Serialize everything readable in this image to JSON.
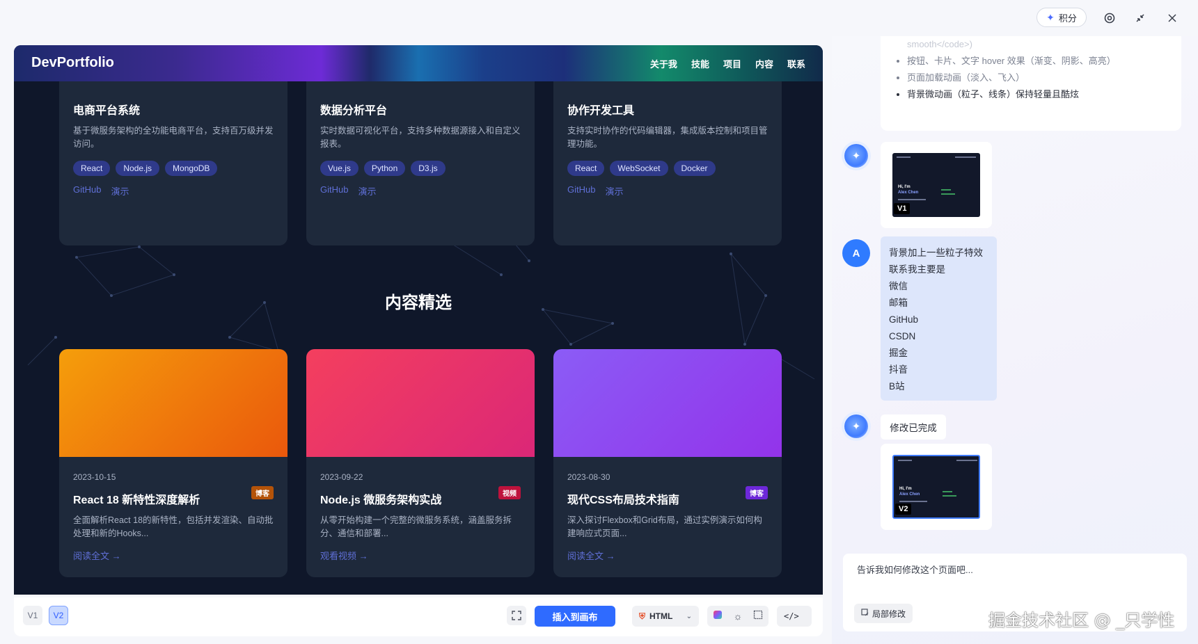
{
  "topbar": {
    "credit_label": "积分",
    "icons": [
      "sparkle-icon",
      "settings-icon",
      "collapse-icon",
      "close-icon"
    ]
  },
  "preview": {
    "nav": {
      "logo": "DevPortfolio",
      "links": [
        "关于我",
        "技能",
        "项目",
        "内容",
        "联系"
      ]
    },
    "projects": [
      {
        "title": "电商平台系统",
        "desc": "基于微服务架构的全功能电商平台，支持百万级并发访问。",
        "tags": [
          "React",
          "Node.js",
          "MongoDB"
        ],
        "links": [
          "GitHub",
          "演示"
        ]
      },
      {
        "title": "数据分析平台",
        "desc": "实时数据可视化平台，支持多种数据源接入和自定义报表。",
        "tags": [
          "Vue.js",
          "Python",
          "D3.js"
        ],
        "links": [
          "GitHub",
          "演示"
        ]
      },
      {
        "title": "协作开发工具",
        "desc": "支持实时协作的代码编辑器，集成版本控制和项目管理功能。",
        "tags": [
          "React",
          "WebSocket",
          "Docker"
        ],
        "links": [
          "GitHub",
          "演示"
        ]
      }
    ],
    "section_title": "内容精选",
    "contents": [
      {
        "date": "2023-10-15",
        "badge": "博客",
        "badge_color": "#b45309",
        "title": "React 18 新特性深度解析",
        "desc": "全面解析React 18的新特性，包括并发渲染、自动批处理和新的Hooks...",
        "more": "阅读全文 →",
        "gradient": [
          "#f59e0b",
          "#ea580c"
        ]
      },
      {
        "date": "2023-09-22",
        "badge": "视频",
        "badge_color": "#be123c",
        "title": "Node.js 微服务架构实战",
        "desc": "从零开始构建一个完整的微服务系统，涵盖服务拆分、通信和部署...",
        "more": "观看视频 →",
        "gradient": [
          "#f43f5e",
          "#db2777"
        ]
      },
      {
        "date": "2023-08-30",
        "badge": "博客",
        "badge_color": "#6d28d9",
        "title": "现代CSS布局技术指南",
        "desc": "深入探讨Flexbox和Grid布局，通过实例演示如何构建响应式页面...",
        "more": "阅读全文 →",
        "gradient": [
          "#8b5cf6",
          "#9333ea"
        ]
      }
    ]
  },
  "toolbar": {
    "versions": [
      "V1",
      "V2"
    ],
    "active_version": "V2",
    "insert_label": "插入到画布",
    "format_label": "HTML",
    "code_label": "</>"
  },
  "chat": {
    "previous_items": [
      "smooth</code>)",
      "按钮、卡片、文字 hover 效果（渐变、阴影、高亮）",
      "页面加载动画（淡入、飞入）",
      "背景微动画（粒子、线条）保持轻量且酷炫"
    ],
    "thumb1_label": "V1",
    "thumb2_label": "V2",
    "thumb_heading": "Hi, I'm",
    "thumb_name": "Alex Chen",
    "user_avatar": "A",
    "user_message_lines": [
      "背景加上一些粒子特效",
      "联系我主要是",
      "微信",
      "邮箱",
      "GitHub",
      "CSDN",
      "掘金",
      "抖音",
      "B站"
    ],
    "ai_reply": "修改已完成",
    "input_placeholder": "告诉我如何修改这个页面吧...",
    "local_edit_label": "局部修改"
  },
  "watermark": "掘金技术社区 @ _只学性"
}
